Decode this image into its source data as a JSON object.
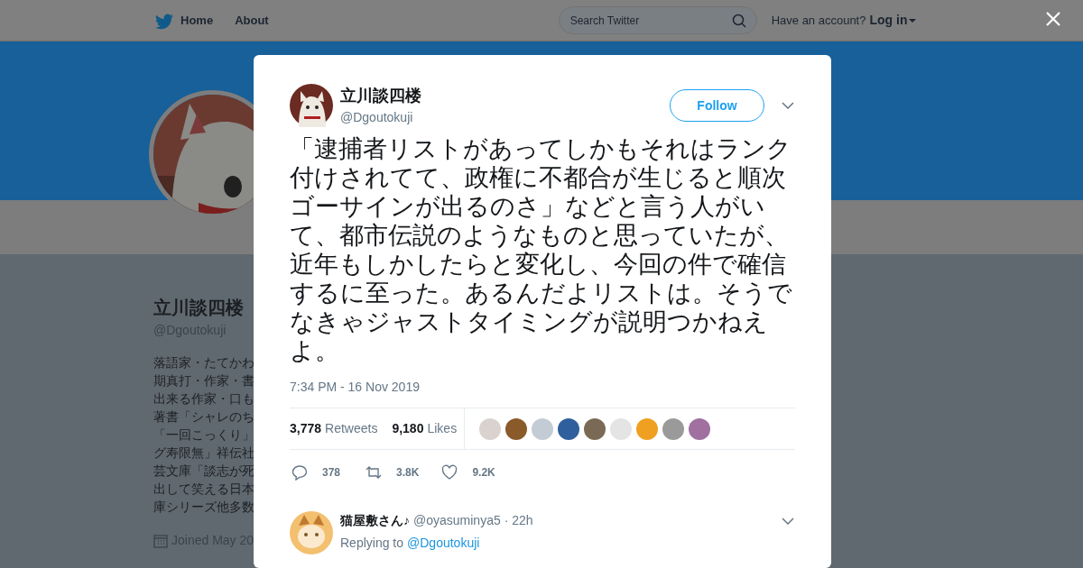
{
  "nav": {
    "items": [
      {
        "label": "Home"
      },
      {
        "label": "About"
      }
    ],
    "search": {
      "placeholder": "Search Twitter"
    },
    "account_prompt": "Have an account?",
    "login": "Log in"
  },
  "profile": {
    "name": "立川談四楼",
    "handle": "@Dgoutokuji",
    "bio_lines": [
      "落語家・たてかわ",
      "期真打・作家・書",
      "出来る作家・口も",
      "著書「シャレのち",
      "「一回こっくり」",
      "グ寿限無」祥伝社",
      "芸文庫「談志が死",
      "出して笑える日本",
      "庫シリーズ他多数"
    ],
    "joined": "Joined May 20"
  },
  "tweet": {
    "name": "立川談四楼",
    "handle": "@Dgoutokuji",
    "follow": "Follow",
    "text": "「逮捕者リストがあってしかもそれはランク付けされてて、政権に不都合が生じると順次ゴーサインが出るのさ」などと言う人がいて、都市伝説のようなものと思っていたが、近年もしかしたらと変化し、今回の件で確信するに至った。あるんだよリストは。そうでなきゃジャストタイミングが説明つかねえよ。",
    "timestamp": "7:34 PM - 16 Nov 2019",
    "retweets_count": "3,778",
    "retweets_label": "Retweets",
    "likes_count": "9,180",
    "likes_label": "Likes",
    "likers": [
      {
        "color": "#d9d2cf"
      },
      {
        "color": "#8a5a2a"
      },
      {
        "color": "#c3ccd4"
      },
      {
        "color": "#2f5f9c"
      },
      {
        "color": "#7a6a55"
      },
      {
        "color": "#e4e4e4"
      },
      {
        "color": "#f0a020"
      },
      {
        "color": "#9a9a9a"
      },
      {
        "color": "#a070a0"
      }
    ],
    "actions": {
      "replies": "378",
      "retweets": "3.8K",
      "likes": "9.2K"
    }
  },
  "reply": {
    "name": "猫屋敷さん♪",
    "handle": "@oyasuminya5",
    "time": "· 22h",
    "replying_prefix": "Replying to",
    "replying_to": "@Dgoutokuji"
  }
}
